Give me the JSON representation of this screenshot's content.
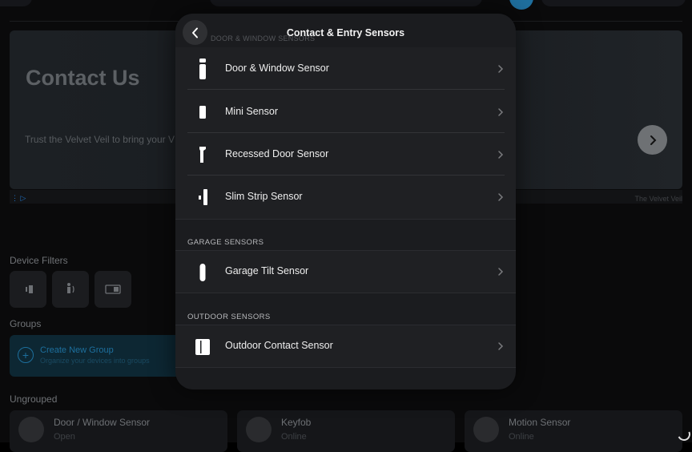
{
  "modal": {
    "title": "Contact & Entry Sensors",
    "ghost_section": "DOOR & WINDOW SENSORS",
    "groups": [
      {
        "header": "",
        "items": [
          {
            "label": "Door & Window Sensor",
            "icon": "door-window-sensor-icon"
          },
          {
            "label": "Mini Sensor",
            "icon": "mini-sensor-icon"
          },
          {
            "label": "Recessed Door Sensor",
            "icon": "recessed-door-sensor-icon"
          },
          {
            "label": "Slim Strip Sensor",
            "icon": "slim-strip-sensor-icon"
          }
        ]
      },
      {
        "header": "GARAGE SENSORS",
        "items": [
          {
            "label": "Garage Tilt Sensor",
            "icon": "garage-tilt-sensor-icon"
          }
        ]
      },
      {
        "header": "OUTDOOR SENSORS",
        "items": [
          {
            "label": "Outdoor Contact Sensor",
            "icon": "outdoor-contact-sensor-icon"
          }
        ]
      }
    ]
  },
  "ad": {
    "title": "Contact Us",
    "text": "Trust the Velvet Veil to bring your V",
    "brand": "The Velvet Veil"
  },
  "background": {
    "device_filters_label": "Device Filters",
    "groups_label": "Groups",
    "create_group_title": "Create New Group",
    "create_group_subtitle": "Organize your devices into groups",
    "ungrouped_label": "Ungrouped",
    "devices": [
      {
        "name": "Door / Window Sensor",
        "status": "Open"
      },
      {
        "name": "Keyfob",
        "status": "Online"
      },
      {
        "name": "Motion Sensor",
        "status": "Online"
      }
    ]
  },
  "colors": {
    "modal_bg": "#1b1c1f",
    "accent": "#1d6f9d"
  }
}
